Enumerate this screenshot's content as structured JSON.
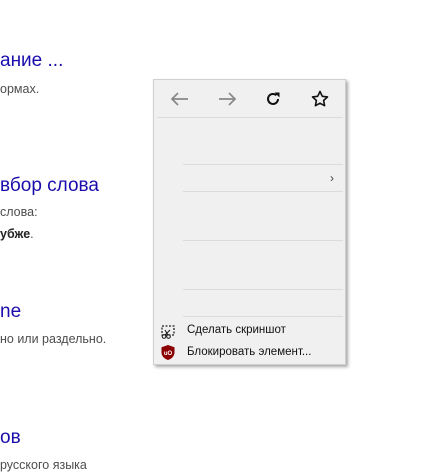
{
  "background_results": [
    {
      "title": "ание ...",
      "snippet": "ормах."
    },
    {
      "title": "вбор слова",
      "snippet": "слова:",
      "snippet_bold": "убже",
      "snippet_after_bold": "."
    },
    {
      "title": "ne",
      "snippet": "но или раздельно."
    },
    {
      "title": "ов",
      "snippet": "русского языка"
    }
  ],
  "context_menu": {
    "nav": {
      "back_icon": "arrow-left-icon",
      "forward_icon": "arrow-right-icon",
      "reload_icon": "reload-icon",
      "bookmark_icon": "star-icon"
    },
    "submenu_arrow": "›",
    "items": [
      {
        "label": "Сделать скриншот",
        "icon": "screenshot-icon"
      },
      {
        "label": "Блокировать элемент...",
        "icon": "ublock-shield-icon",
        "icon_text": "uO"
      }
    ],
    "colors": {
      "menu_bg": "#f0f0f0",
      "ublock_red": "#8b0000",
      "link": "#1a0dab"
    }
  }
}
